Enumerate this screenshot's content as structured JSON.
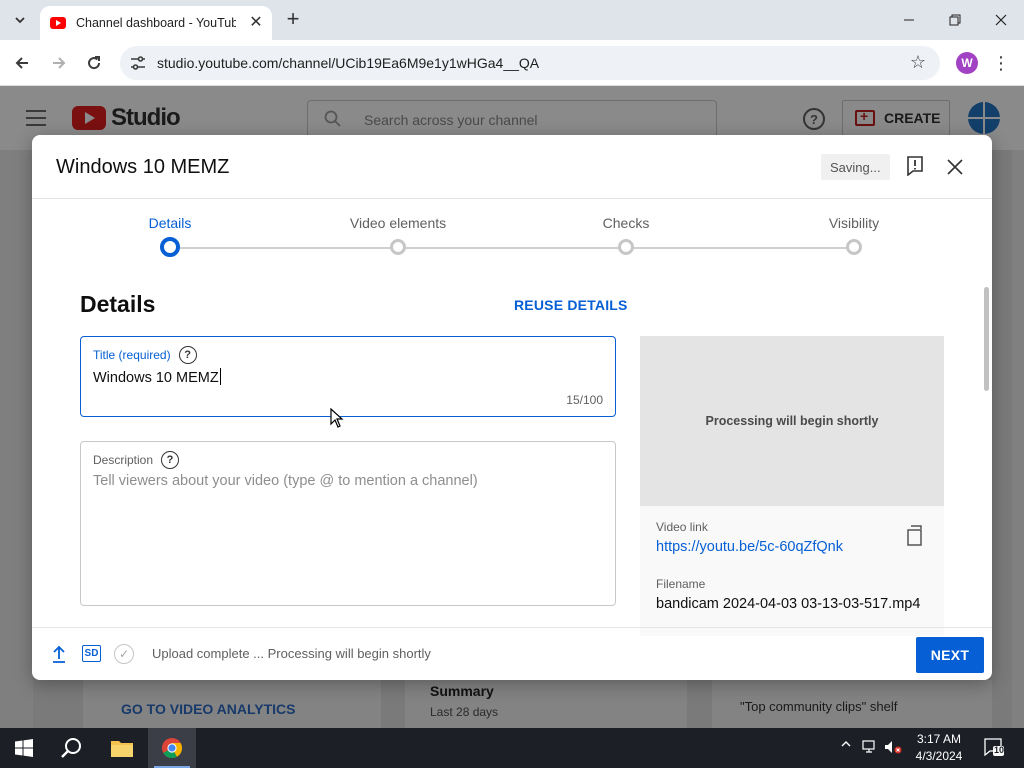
{
  "browser": {
    "tab_title": "Channel dashboard - YouTube",
    "url": "studio.youtube.com/channel/UCib19Ea6M9e1y1wHGa4__QA",
    "profile_initial": "W"
  },
  "studio": {
    "logo_text": "Studio",
    "search_placeholder": "Search across your channel",
    "help_glyph": "?",
    "create_label": "CREATE",
    "analytics_link": "GO TO VIDEO ANALYTICS",
    "summary_title": "Summary",
    "summary_period": "Last 28 days",
    "clips_text": "\"Top community clips\" shelf"
  },
  "modal": {
    "title": "Windows 10 MEMZ",
    "saving_label": "Saving...",
    "steps": [
      {
        "label": "Details",
        "active": true
      },
      {
        "label": "Video elements",
        "active": false
      },
      {
        "label": "Checks",
        "active": false
      },
      {
        "label": "Visibility",
        "active": false
      }
    ],
    "section_heading": "Details",
    "reuse_label": "REUSE DETAILS",
    "title_field": {
      "label": "Title (required)",
      "value": "Windows 10 MEMZ",
      "count": "15/100"
    },
    "description_field": {
      "label": "Description",
      "placeholder": "Tell viewers about your video (type @ to mention a channel)"
    },
    "help_glyph": "?",
    "preview": {
      "processing_text": "Processing will begin shortly",
      "video_link_label": "Video link",
      "video_link": "https://youtu.be/5c-60qZfQnk",
      "filename_label": "Filename",
      "filename": "bandicam 2024-04-03 03-13-03-517.mp4"
    },
    "footer": {
      "sd_badge": "SD",
      "check_glyph": "✓",
      "status_text": "Upload complete ... Processing will begin shortly",
      "next_label": "NEXT"
    }
  },
  "taskbar": {
    "time": "3:17 AM",
    "date": "4/3/2024",
    "notification_count": "10"
  },
  "colors": {
    "accent_blue": "#065fd4",
    "youtube_red": "#ff0000",
    "taskbar": "#1c1f26"
  }
}
